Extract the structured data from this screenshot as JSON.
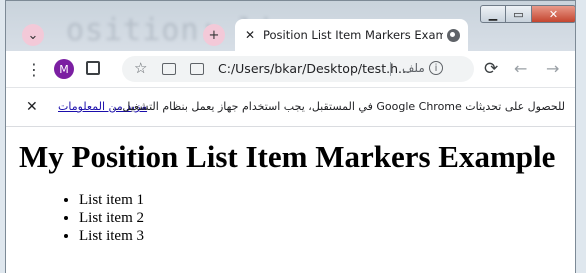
{
  "background_text": "osition: li",
  "tab": {
    "title": "Position List Item Markers Examp",
    "close_glyph": "✕"
  },
  "tabstrip": {
    "tab_search_glyph": "⌄",
    "new_tab_glyph": "+"
  },
  "window_controls": {
    "minimize": "▁",
    "maximize": "▭",
    "close": "✕"
  },
  "toolbar": {
    "menu_glyph": "⋮",
    "profile_initial": "M",
    "reload_glyph": "⟳",
    "back_glyph": "←",
    "forward_glyph": "→",
    "star_glyph": "☆",
    "address": {
      "url": "C:/Users/bkar/Desktop/test.h...",
      "scheme_label": "ملف",
      "info_glyph": "i"
    }
  },
  "infobar": {
    "close_glyph": "✕",
    "learn_more": "مزيد من المعلومات",
    "message": "للحصول على تحديثات Google Chrome في المستقبل، يجب استخدام جهاز يعمل بنظام التشغيل..."
  },
  "page": {
    "heading": "My Position List Item Markers Example",
    "items": [
      "List item 1",
      "List item 2",
      "List item 3"
    ]
  }
}
